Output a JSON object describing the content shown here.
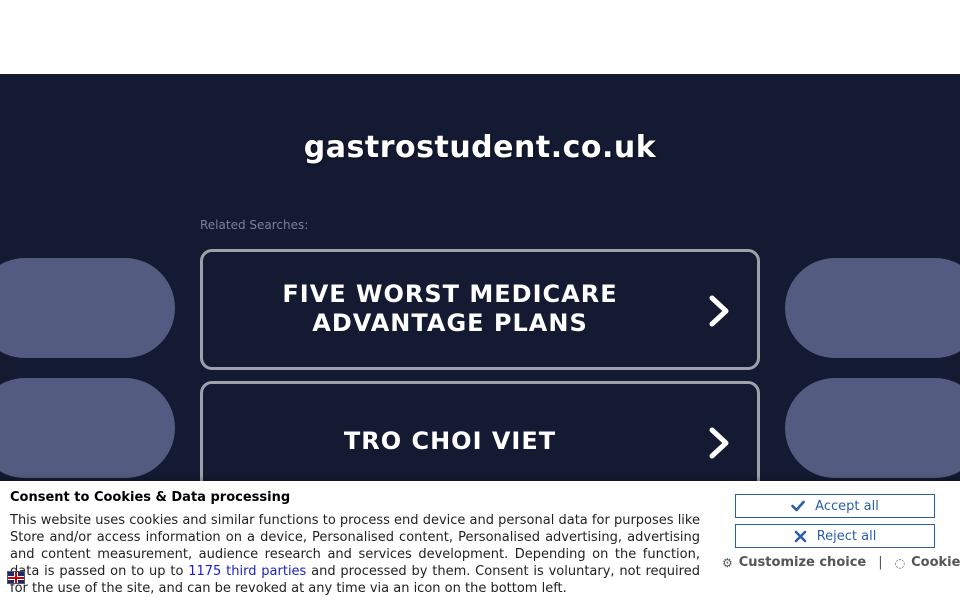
{
  "page": {
    "site_title": "gastrostudent.co.uk",
    "related_label": "Related Searches:"
  },
  "searches": [
    {
      "label_line1": "FIVE WORST MEDICARE",
      "label_line2": "ADVANTAGE PLANS",
      "icon": "chevron-right-icon"
    },
    {
      "label_line1": "TRO CHOI VIET",
      "label_line2": "",
      "icon": "chevron-right-icon"
    }
  ],
  "consent": {
    "title": "Consent to Cookies & Data processing",
    "text_before_link": "This website uses cookies and similar functions to process end device and personal data for purposes like Store and/or access information on a device, Personalised content, Personalised advertising, advertising and content measurement, audience research and services development. Depending on the function, data is passed on to up to ",
    "link_text": "1175 third parties",
    "text_after_link": " and processed by them. Consent is voluntary, not required for the use of the site, and can be revoked at any time via an icon on the bottom left.",
    "accept_label": "Accept all",
    "reject_label": "Reject all",
    "customize_label": "Customize choice",
    "separator": "|",
    "cookies_label": "Cookies",
    "language_icon": "uk-flag-icon"
  },
  "colors": {
    "background_dark": "#141a31",
    "pill": "#535c80",
    "button_border": "#9ea1ab",
    "consent_accent": "#2a5fa8",
    "link": "#1a1fc4"
  }
}
